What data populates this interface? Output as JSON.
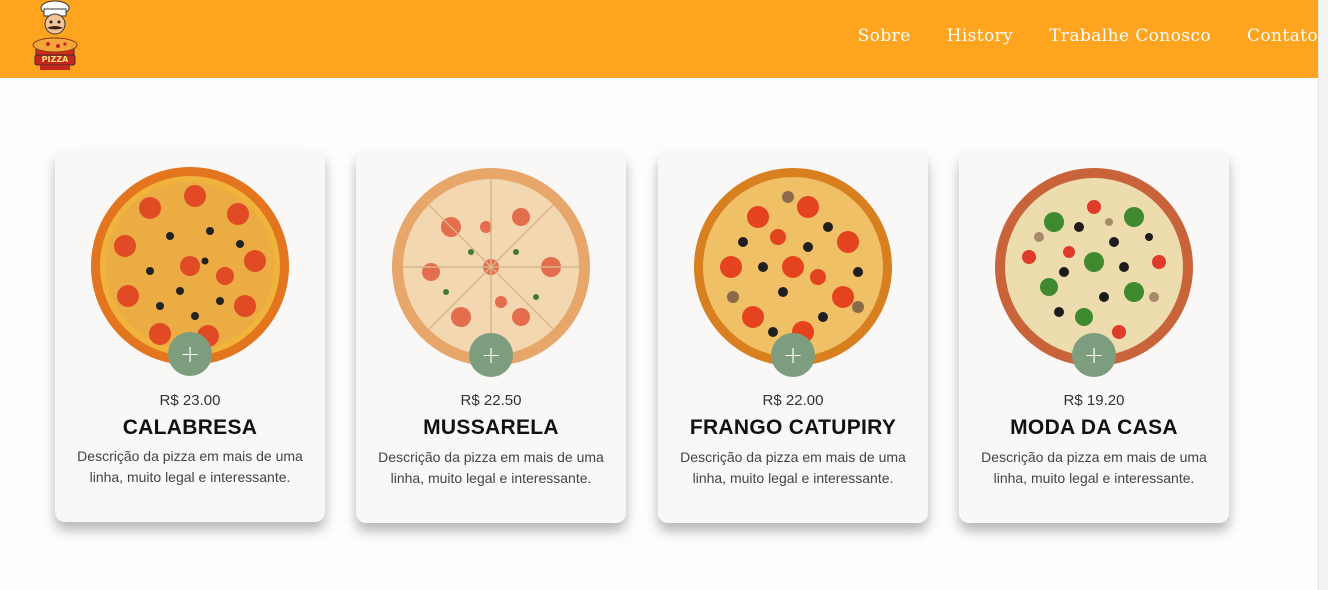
{
  "header": {
    "logo_text": "PIZZA",
    "nav": [
      "Sobre",
      "History",
      "Trabalhe Conosco",
      "Contato"
    ]
  },
  "colors": {
    "header_bg": "#ffa41f",
    "add_button": "#7d9e7e"
  },
  "products": [
    {
      "price": "R$ 23.00",
      "name": "CALABRESA",
      "description": "Descrição da pizza em mais de uma linha, muito legal e interessante.",
      "add_label": "+",
      "image": "pizza-calabresa-image"
    },
    {
      "price": "R$ 22.50",
      "name": "MUSSARELA",
      "description": "Descrição da pizza em mais de uma linha, muito legal e interessante.",
      "add_label": "+",
      "image": "pizza-mussarela-image"
    },
    {
      "price": "R$ 22.00",
      "name": "FRANGO CATUPIRY",
      "description": "Descrição da pizza em mais de uma linha, muito legal e interessante.",
      "add_label": "+",
      "image": "pizza-frango-catupiry-image"
    },
    {
      "price": "R$ 19.20",
      "name": "MODA DA CASA",
      "description": "Descrição da pizza em mais de uma linha, muito legal e interessante.",
      "add_label": "+",
      "image": "pizza-moda-da-casa-image"
    }
  ]
}
